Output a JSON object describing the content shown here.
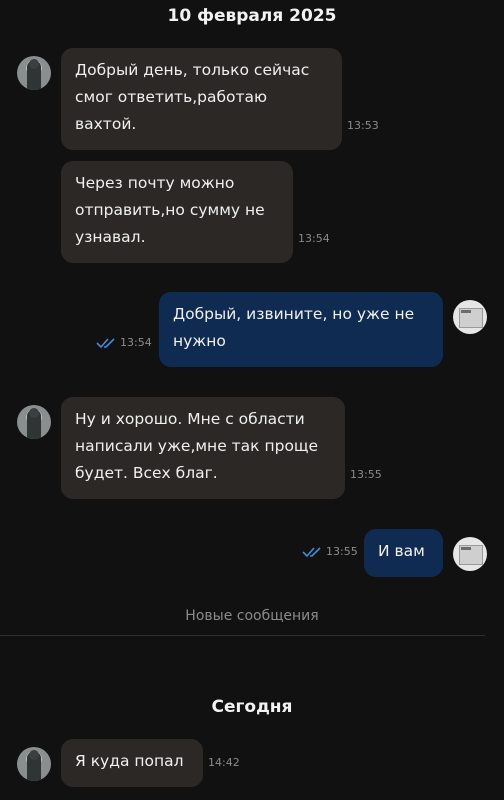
{
  "dates": {
    "first": "10 февраля 2025",
    "today": "Сегодня"
  },
  "new_messages_label": "Новые сообщения",
  "messages": [
    {
      "direction": "in",
      "text": "Добрый день, только сейчас\nсмог ответить,работаю\nвахтой.",
      "time": "13:53"
    },
    {
      "direction": "in",
      "text": "Через почту можно\nотправить,но сумму не\nузнавал.",
      "time": "13:54"
    },
    {
      "direction": "out",
      "text": "Добрый, извините, но уже не\nнужно",
      "time": "13:54",
      "status": "read"
    },
    {
      "direction": "in",
      "text": "Ну и хорошо. Мне с области\nнаписали уже,мне так проще\nбудет. Всех благ.",
      "time": "13:55"
    },
    {
      "direction": "out",
      "text": "И вам",
      "time": "13:55",
      "status": "read"
    },
    {
      "direction": "in",
      "text": "Я куда попал",
      "time": "14:42"
    }
  ],
  "colors": {
    "background": "#111111",
    "incoming_bubble": "#2b2826",
    "outgoing_bubble": "#102b51",
    "read_check": "#3c8ddc"
  },
  "icons": {
    "read_status": "double-check-icon"
  }
}
